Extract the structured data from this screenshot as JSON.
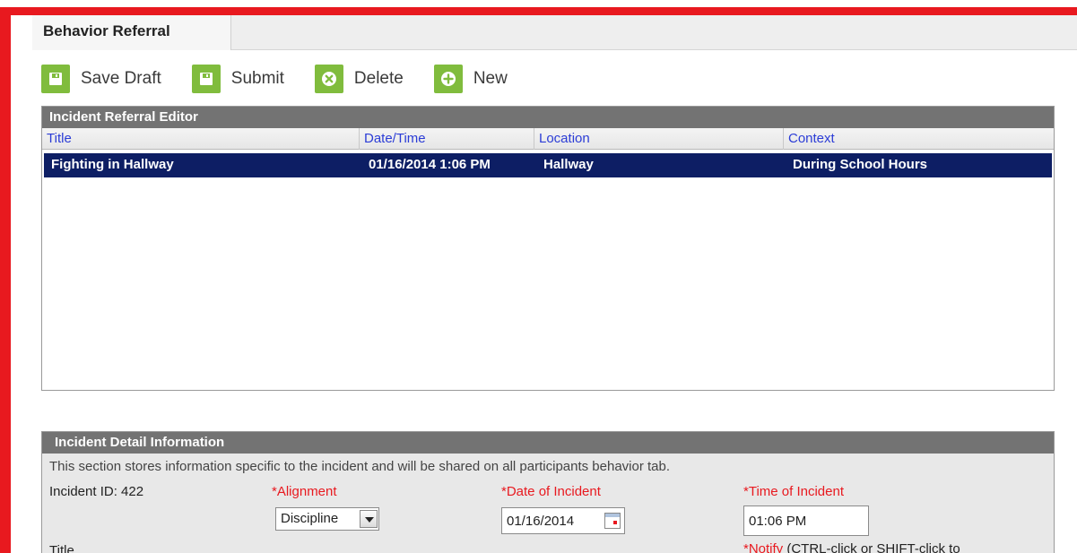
{
  "tab": {
    "label": "Behavior Referral"
  },
  "toolbar": {
    "save_draft": "Save Draft",
    "submit": "Submit",
    "delete": "Delete",
    "new": "New"
  },
  "editor": {
    "title": "Incident Referral Editor",
    "columns": [
      "Title",
      "Date/Time",
      "Location",
      "Context"
    ],
    "rows": [
      {
        "title": "Fighting in Hallway",
        "datetime": "01/16/2014 1:06 PM",
        "location": "Hallway",
        "context": "During School Hours"
      }
    ]
  },
  "detail": {
    "title": "Incident Detail Information",
    "description": "This section stores information specific to the incident and will be shared on all participants behavior tab.",
    "incident_id_label": "Incident ID: 422",
    "alignment_label": "*Alignment",
    "alignment_value": "Discipline",
    "date_label": "*Date of Incident",
    "date_value": "01/16/2014",
    "time_label": "*Time of Incident",
    "time_value": "01:06 PM",
    "title_label": "Title",
    "notify_label": "*Notify",
    "notify_hint": "(CTRL-click or SHIFT-click to"
  },
  "colors": {
    "frame": "#e8191f",
    "accent_green": "#80bc3d",
    "selected_row": "#0d1e64",
    "header_gray": "#737373"
  }
}
